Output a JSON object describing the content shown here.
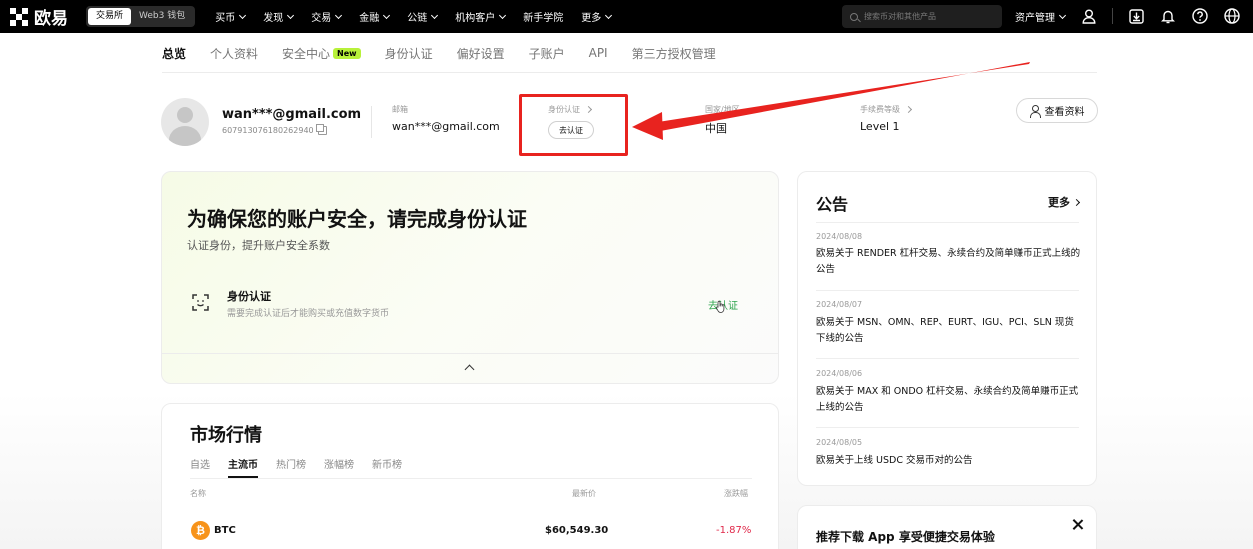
{
  "nav": {
    "logo": "欧易",
    "switch": [
      "交易所",
      "Web3 钱包"
    ],
    "menu": [
      "买币",
      "发现",
      "交易",
      "金融",
      "公链",
      "机构客户",
      "新手学院",
      "更多"
    ],
    "search_placeholder": "搜索币对和其他产品",
    "asset_menu": "资产管理",
    "icons": [
      "user-icon",
      "download-icon",
      "bell-icon",
      "help-icon",
      "globe-icon"
    ]
  },
  "subtabs": [
    {
      "label": "总览"
    },
    {
      "label": "个人资料"
    },
    {
      "label": "安全中心",
      "badge": "New"
    },
    {
      "label": "身份认证"
    },
    {
      "label": "偏好设置"
    },
    {
      "label": "子账户"
    },
    {
      "label": "API"
    },
    {
      "label": "第三方授权管理"
    }
  ],
  "profile": {
    "email_masked": "wan***@gmail.com",
    "uid": "607913076180262940",
    "email_label": "邮箱",
    "email_value": "wan***@gmail.com",
    "kyc_label": "身份认证",
    "kyc_button": "去认证",
    "region_label": "国家/地区",
    "region_value": "中国",
    "fee_label": "手续费等级",
    "fee_value": "Level 1",
    "view_button": "查看资料"
  },
  "security": {
    "title": "为确保您的账户安全，请完成身份认证",
    "subtitle": "认证身份，提升账户安全系数",
    "item_title": "身份认证",
    "item_desc": "需要完成认证后才能购买或充值数字货币",
    "item_link": "去认证"
  },
  "market": {
    "title": "市场行情",
    "tabs": [
      "自选",
      "主流币",
      "热门榜",
      "涨幅榜",
      "新币榜"
    ],
    "columns": [
      "名称",
      "最新价",
      "涨跌幅"
    ],
    "rows": [
      {
        "symbol": "BTC",
        "price": "$60,549.30",
        "change": "-1.87%"
      }
    ]
  },
  "announcements": {
    "title": "公告",
    "more": "更多",
    "items": [
      {
        "date": "2024/08/08",
        "text": "欧易关于 RENDER 杠杆交易、永续合约及简单赚币正式上线的公告"
      },
      {
        "date": "2024/08/07",
        "text": "欧易关于 MSN、OMN、REP、EURT、IGU、PCI、SLN 现货下线的公告"
      },
      {
        "date": "2024/08/06",
        "text": "欧易关于 MAX 和 ONDO 杠杆交易、永续合约及简单赚币正式上线的公告"
      },
      {
        "date": "2024/08/05",
        "text": "欧易关于上线 USDC 交易币对的公告"
      }
    ]
  },
  "app_banner": {
    "text": "推荐下载 App 享受便捷交易体验"
  },
  "colors": {
    "highlight": "#e8231f",
    "accent_green": "#b8f13a",
    "positive": "#2aa34a",
    "negative": "#e0294a"
  }
}
